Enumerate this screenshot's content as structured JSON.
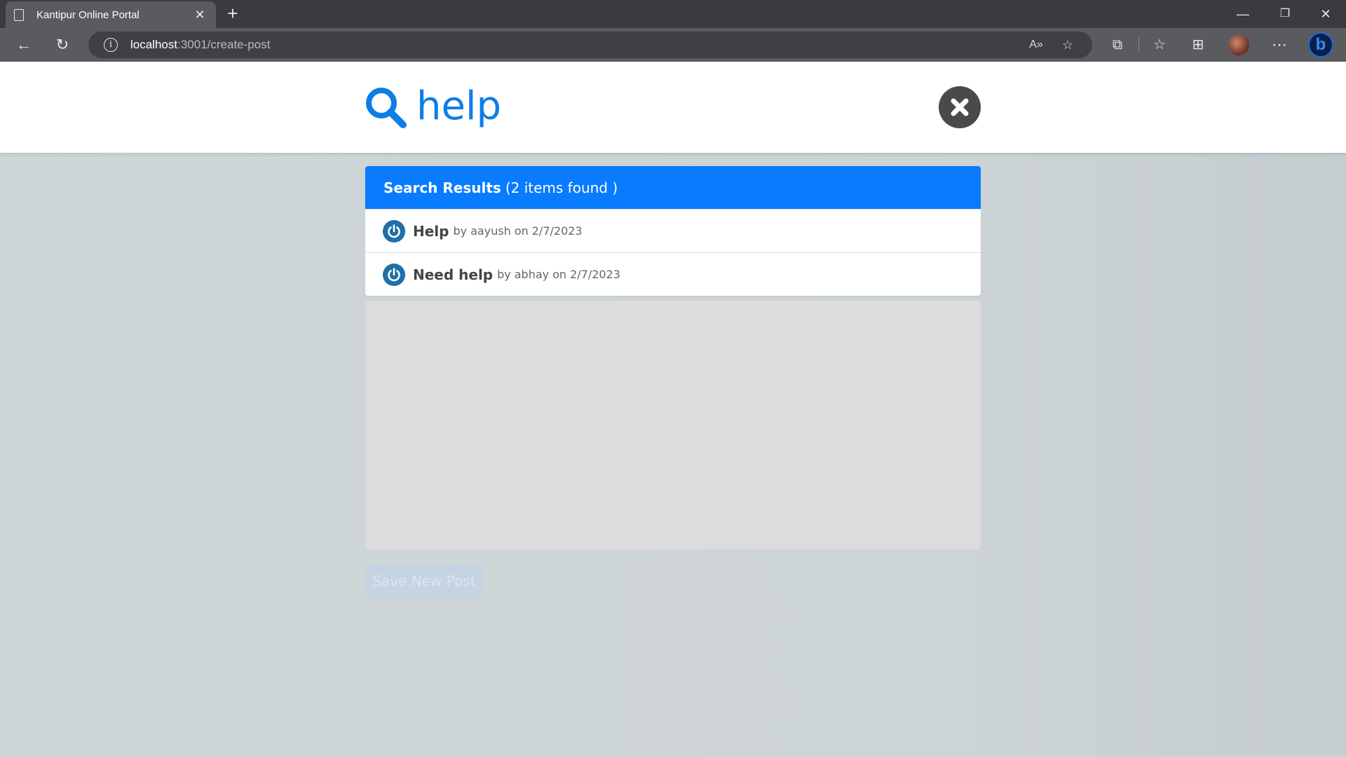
{
  "browser": {
    "tab_title": "Kantipur Online Portal",
    "url_host": "localhost",
    "url_path": ":3001/create-post"
  },
  "search": {
    "query": "help"
  },
  "results": {
    "title": "Search Results",
    "count_text": "(2 items found )",
    "items": [
      {
        "title": "Help",
        "by": "by",
        "author": "aayush",
        "on": "on",
        "date": "2/7/2023"
      },
      {
        "title": "Need help",
        "by": "by",
        "author": "abhay",
        "on": "on",
        "date": "2/7/2023"
      }
    ]
  },
  "form": {
    "save_label": "Save New Post"
  },
  "colors": {
    "accent": "#087bff",
    "search_text": "#0d7ee8"
  }
}
